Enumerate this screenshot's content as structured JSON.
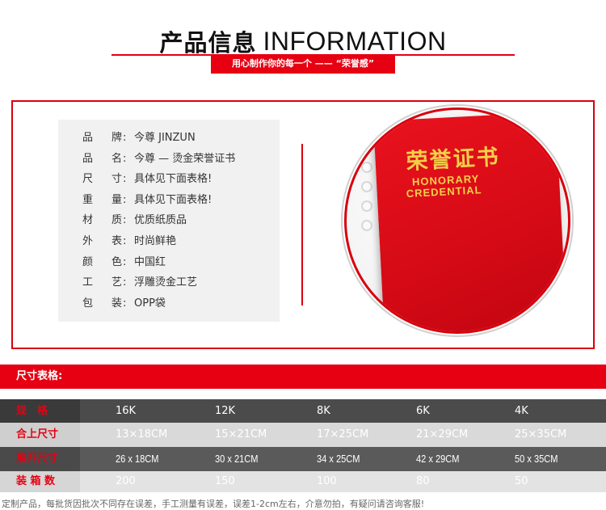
{
  "header": {
    "title_cn": "产品信息",
    "title_en": "INFORMATION",
    "tagline": "用心制作你的每一个 —— “荣誉感”"
  },
  "specs": [
    {
      "k1": "品",
      "k2": "牌",
      "value": "今尊 JINZUN"
    },
    {
      "k1": "品",
      "k2": "名",
      "value": "今尊 — 烫金荣誉证书"
    },
    {
      "k1": "尺",
      "k2": "寸",
      "value": "具体见下面表格!"
    },
    {
      "k1": "重",
      "k2": "量",
      "value": "具体见下面表格!"
    },
    {
      "k1": "材",
      "k2": "质",
      "value": "优质纸质品"
    },
    {
      "k1": "外",
      "k2": "表",
      "value": "时尚鲜艳"
    },
    {
      "k1": "颜",
      "k2": "色",
      "value": "中国红"
    },
    {
      "k1": "工",
      "k2": "艺",
      "value": "浮雕烫金工艺"
    },
    {
      "k1": "包",
      "k2": "装",
      "value": "OPP袋"
    }
  ],
  "colon": ":",
  "product_image": {
    "cover_cn": "荣誉证书",
    "cover_en_line1": "HONORARY",
    "cover_en_line2": "CREDENTIAL"
  },
  "size_table": {
    "title": "尺寸表格:",
    "rows": [
      {
        "label": "规　格",
        "cells": [
          "16K",
          "12K",
          "8K",
          "6K",
          "4K"
        ]
      },
      {
        "label": "合上尺寸",
        "cells": [
          "13×18CM",
          "15×21CM",
          "17×25CM",
          "21×29CM",
          "25×35CM"
        ]
      },
      {
        "label": "展开尺寸",
        "cells": [
          "26 x 18CM",
          "30 x 21CM",
          "34 x 25CM",
          "42 x 29CM",
          "50 x 35CM"
        ]
      },
      {
        "label": "装 箱 数",
        "cells": [
          "200",
          "150",
          "100",
          "80",
          "50"
        ]
      }
    ]
  },
  "footer_note": "定制产品，每批货因批次不同存在误差，手工测量有误差，误差1-2cm左右，介意勿拍，有疑问请咨询客服!",
  "colors": {
    "accent_red": "#e60012",
    "row1_bg": "#4b4b4b",
    "row2_bg": "#d9d9d9",
    "row3_bg": "#5a5a5a",
    "row4_bg": "#e3e3e3",
    "cover_gold": "#f2cf4a"
  }
}
